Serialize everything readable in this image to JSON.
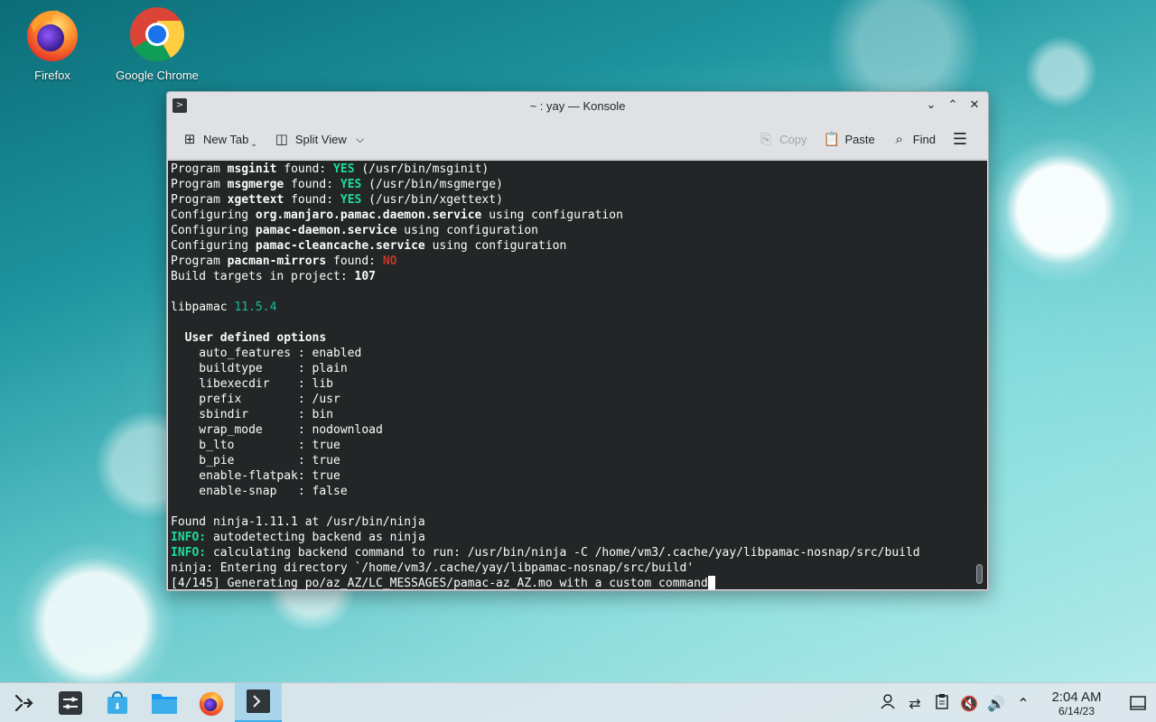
{
  "desktop": {
    "icons": [
      {
        "label": "Firefox",
        "icon": "firefox-icon"
      },
      {
        "label": "Google Chrome",
        "icon": "chrome-icon"
      }
    ]
  },
  "window": {
    "title": "~ : yay — Konsole",
    "toolbar": {
      "new_tab": "New Tab",
      "split_view": "Split View",
      "copy": "Copy",
      "paste": "Paste",
      "find": "Find"
    }
  },
  "terminal": {
    "lines": [
      [
        {
          "t": "Program "
        },
        {
          "t": "msginit",
          "c": "b"
        },
        {
          "t": " found: "
        },
        {
          "t": "YES",
          "c": "green"
        },
        {
          "t": " (/usr/bin/msginit)"
        }
      ],
      [
        {
          "t": "Program "
        },
        {
          "t": "msgmerge",
          "c": "b"
        },
        {
          "t": " found: "
        },
        {
          "t": "YES",
          "c": "green"
        },
        {
          "t": " (/usr/bin/msgmerge)"
        }
      ],
      [
        {
          "t": "Program "
        },
        {
          "t": "xgettext",
          "c": "b"
        },
        {
          "t": " found: "
        },
        {
          "t": "YES",
          "c": "green"
        },
        {
          "t": " (/usr/bin/xgettext)"
        }
      ],
      [
        {
          "t": "Configuring "
        },
        {
          "t": "org.manjaro.pamac.daemon.service",
          "c": "b"
        },
        {
          "t": " using configuration"
        }
      ],
      [
        {
          "t": "Configuring "
        },
        {
          "t": "pamac-daemon.service",
          "c": "b"
        },
        {
          "t": " using configuration"
        }
      ],
      [
        {
          "t": "Configuring "
        },
        {
          "t": "pamac-cleancache.service",
          "c": "b"
        },
        {
          "t": " using configuration"
        }
      ],
      [
        {
          "t": "Program "
        },
        {
          "t": "pacman-mirrors",
          "c": "b"
        },
        {
          "t": " found: "
        },
        {
          "t": "NO",
          "c": "red"
        }
      ],
      [
        {
          "t": "Build targets in project: "
        },
        {
          "t": "107",
          "c": "b"
        }
      ],
      [],
      [
        {
          "t": "libpamac "
        },
        {
          "t": "11.5.4",
          "c": "teal"
        }
      ],
      [],
      [
        {
          "t": "  "
        },
        {
          "t": "User defined options",
          "c": "b"
        }
      ],
      [
        {
          "t": "    auto_features : enabled"
        }
      ],
      [
        {
          "t": "    buildtype     : plain"
        }
      ],
      [
        {
          "t": "    libexecdir    : lib"
        }
      ],
      [
        {
          "t": "    prefix        : /usr"
        }
      ],
      [
        {
          "t": "    sbindir       : bin"
        }
      ],
      [
        {
          "t": "    wrap_mode     : nodownload"
        }
      ],
      [
        {
          "t": "    b_lto         : true"
        }
      ],
      [
        {
          "t": "    b_pie         : true"
        }
      ],
      [
        {
          "t": "    enable-flatpak: true"
        }
      ],
      [
        {
          "t": "    enable-snap   : false"
        }
      ],
      [],
      [
        {
          "t": "Found ninja-1.11.1 at /usr/bin/ninja"
        }
      ],
      [
        {
          "t": "INFO:",
          "c": "green"
        },
        {
          "t": " autodetecting backend as ninja"
        }
      ],
      [
        {
          "t": "INFO:",
          "c": "green"
        },
        {
          "t": " calculating backend command to run: /usr/bin/ninja -C /home/vm3/.cache/yay/libpamac-nosnap/src/build"
        }
      ],
      [
        {
          "t": "ninja: Entering directory `/home/vm3/.cache/yay/libpamac-nosnap/src/build'"
        }
      ],
      [
        {
          "t": "[4/145] Generating po/az_AZ/LC_MESSAGES/pamac-az_AZ.mo with a custom command"
        },
        {
          "cursor": true
        }
      ]
    ]
  },
  "taskbar": {
    "items": [
      "app-launcher-icon",
      "system-settings-icon",
      "discover-icon",
      "dolphin-icon",
      "firefox-icon",
      "konsole-icon"
    ],
    "tray": [
      "user-icon",
      "network-icon",
      "clipboard-icon",
      "mute-icon",
      "volume-icon",
      "chevron-up-icon"
    ],
    "time": "2:04 AM",
    "date": "6/14/23"
  }
}
